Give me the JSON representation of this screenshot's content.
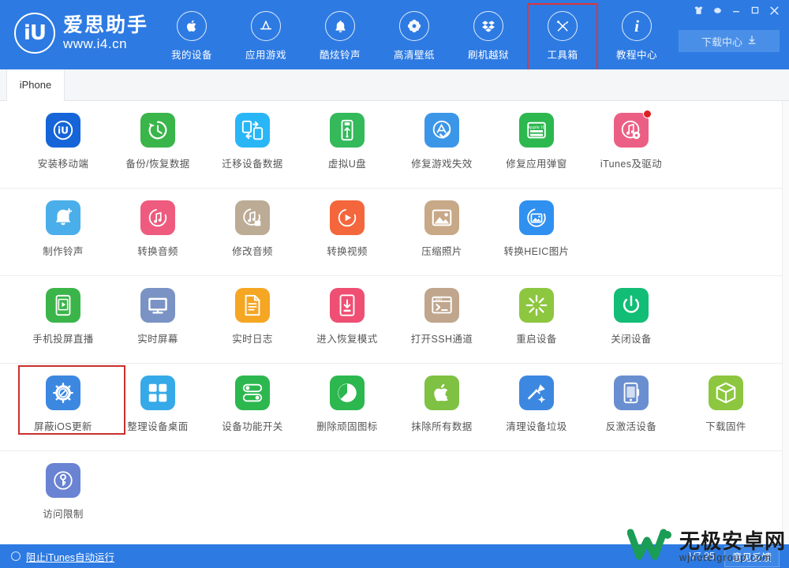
{
  "colors": {
    "header_bg": "#2d7ae2",
    "accent_red": "#c9302c",
    "badge_red": "#e02020"
  },
  "header": {
    "brand": {
      "logo_text": "iU",
      "name_cn": "爱思助手",
      "url": "www.i4.cn"
    },
    "nav": [
      {
        "label": "我的设备",
        "icon": "apple-icon",
        "active": false
      },
      {
        "label": "应用游戏",
        "icon": "appstore-icon",
        "active": false
      },
      {
        "label": "酷炫铃声",
        "icon": "bell-icon",
        "active": false
      },
      {
        "label": "高清壁纸",
        "icon": "flower-icon",
        "active": false
      },
      {
        "label": "刷机越狱",
        "icon": "dropbox-icon",
        "active": false
      },
      {
        "label": "工具箱",
        "icon": "tools-icon",
        "active": true
      },
      {
        "label": "教程中心",
        "icon": "info-icon",
        "active": false
      }
    ],
    "window_buttons": [
      {
        "name": "skin-icon",
        "glyph": "♉"
      },
      {
        "name": "settings-icon",
        "glyph": "✿"
      },
      {
        "name": "minimize-icon",
        "glyph": "—"
      },
      {
        "name": "maximize-icon",
        "glyph": "▢"
      },
      {
        "name": "close-icon",
        "glyph": "✕"
      }
    ],
    "download_center": {
      "label": "下载中心",
      "icon": "download-icon"
    }
  },
  "tabs": [
    {
      "label": "iPhone",
      "active": true
    }
  ],
  "toolbox": {
    "rows": [
      [
        {
          "label": "安装移动端",
          "icon": "i4-app-icon",
          "bg": "#1565d8",
          "badge": false
        },
        {
          "label": "备份/恢复数据",
          "icon": "backup-restore-icon",
          "bg": "#39b54a",
          "badge": false
        },
        {
          "label": "迁移设备数据",
          "icon": "migrate-data-icon",
          "bg": "#29b6f6",
          "badge": false
        },
        {
          "label": "虚拟U盘",
          "icon": "usb-disk-icon",
          "bg": "#34b95b",
          "badge": false
        },
        {
          "label": "修复游戏失效",
          "icon": "fix-game-icon",
          "bg": "#3c96e8",
          "badge": false
        },
        {
          "label": "修复应用弹窗",
          "icon": "appleid-popup-icon",
          "bg": "#2cb74f",
          "badge": false
        },
        {
          "label": "iTunes及驱动",
          "icon": "itunes-driver-icon",
          "bg": "#ec5f85",
          "badge": true
        }
      ],
      [
        {
          "label": "制作铃声",
          "icon": "make-ringtone-icon",
          "bg": "#4aaeea",
          "badge": false
        },
        {
          "label": "转换音频",
          "icon": "convert-audio-icon",
          "bg": "#ee5b7f",
          "badge": false
        },
        {
          "label": "修改音频",
          "icon": "edit-audio-icon",
          "bg": "#bcab95",
          "badge": false
        },
        {
          "label": "转换视频",
          "icon": "convert-video-icon",
          "bg": "#f4663c",
          "badge": false
        },
        {
          "label": "压缩照片",
          "icon": "compress-photo-icon",
          "bg": "#c7a887",
          "badge": false
        },
        {
          "label": "转换HEIC图片",
          "icon": "convert-heic-icon",
          "bg": "#2f90f0",
          "badge": false
        }
      ],
      [
        {
          "label": "手机投屏直播",
          "icon": "screen-cast-icon",
          "bg": "#3bb54a",
          "badge": false
        },
        {
          "label": "实时屏幕",
          "icon": "realtime-screen-icon",
          "bg": "#7a93c4",
          "badge": false
        },
        {
          "label": "实时日志",
          "icon": "realtime-log-icon",
          "bg": "#f5a623",
          "badge": false
        },
        {
          "label": "进入恢复模式",
          "icon": "recovery-mode-icon",
          "bg": "#ee4f73",
          "badge": false
        },
        {
          "label": "打开SSH通道",
          "icon": "ssh-tunnel-icon",
          "bg": "#bfa68d",
          "badge": false
        },
        {
          "label": "重启设备",
          "icon": "reboot-device-icon",
          "bg": "#8dc63f",
          "badge": false
        },
        {
          "label": "关闭设备",
          "icon": "shutdown-device-icon",
          "bg": "#12bd76",
          "badge": false
        }
      ],
      [
        {
          "label": "屏蔽iOS更新",
          "icon": "block-ios-update-icon",
          "bg": "#3c88e0",
          "badge": false,
          "highlight": true
        },
        {
          "label": "整理设备桌面",
          "icon": "organize-desktop-icon",
          "bg": "#36a9e8",
          "badge": false
        },
        {
          "label": "设备功能开关",
          "icon": "feature-toggle-icon",
          "bg": "#2cb74f",
          "badge": false
        },
        {
          "label": "删除顽固图标",
          "icon": "remove-icon-icon",
          "bg": "#2cb74f",
          "badge": false
        },
        {
          "label": "抹除所有数据",
          "icon": "erase-data-icon",
          "bg": "#7ec143",
          "badge": false
        },
        {
          "label": "清理设备垃圾",
          "icon": "clean-junk-icon",
          "bg": "#3c88e0",
          "badge": false
        },
        {
          "label": "反激活设备",
          "icon": "deactivate-device-icon",
          "bg": "#6a8fd0",
          "badge": false
        },
        {
          "label": "下载固件",
          "icon": "download-firmware-icon",
          "bg": "#8dc63f",
          "badge": false
        }
      ],
      [
        {
          "label": "访问限制",
          "icon": "access-restriction-icon",
          "bg": "#6a83d2",
          "badge": false
        }
      ]
    ]
  },
  "footer": {
    "block_itunes_label": "阻止iTunes自动运行",
    "version": "V7.95",
    "feedback_label": "意见反馈"
  },
  "watermark": {
    "name_cn": "无极安卓网",
    "url": "wjhotelgroup.com"
  }
}
